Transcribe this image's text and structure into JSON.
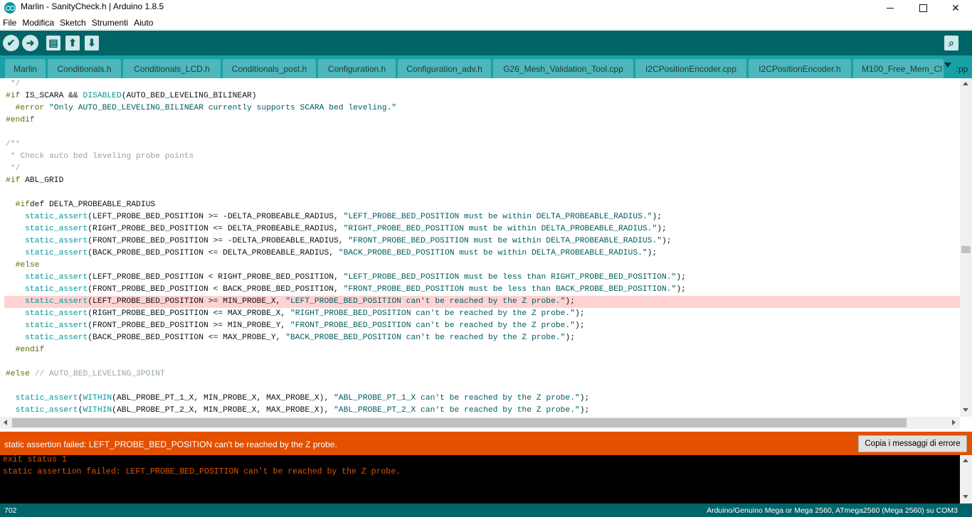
{
  "window": {
    "title": "Marlin - SanityCheck.h | Arduino 1.8.5",
    "minimize_glyph": "",
    "maximize_glyph": "",
    "close_glyph": "✕"
  },
  "menu": [
    "File",
    "Modifica",
    "Sketch",
    "Strumenti",
    "Aiuto"
  ],
  "toolbar": {
    "verify_glyph": "✔",
    "upload_glyph": "➜",
    "new_glyph": "▤",
    "open_glyph": "⬆",
    "save_glyph": "⬇",
    "serial_glyph": "⌕"
  },
  "tabs": [
    "Marlin",
    "Conditionals.h",
    "Conditionals_LCD.h",
    "Conditionals_post.h",
    "Configuration.h",
    "Configuration_adv.h",
    "G26_Mesh_Validation_Tool.cpp",
    "I2CPositionEncoder.cpp",
    "I2CPositionEncoder.h",
    "M100_Free_Mem_Cl",
    ":pp"
  ],
  "code": [
    " */",
    "#if IS_SCARA && DISABLED(AUTO_BED_LEVELING_BILINEAR)",
    "  #error \"Only AUTO_BED_LEVELING_BILINEAR currently supports SCARA bed leveling.\"",
    "#endif",
    "",
    "/**",
    " * Check auto bed leveling probe points",
    " */",
    "#if ABL_GRID",
    "",
    "  #ifdef DELTA_PROBEABLE_RADIUS",
    "    static_assert(LEFT_PROBE_BED_POSITION >= -DELTA_PROBEABLE_RADIUS, \"LEFT_PROBE_BED_POSITION must be within DELTA_PROBEABLE_RADIUS.\");",
    "    static_assert(RIGHT_PROBE_BED_POSITION <= DELTA_PROBEABLE_RADIUS, \"RIGHT_PROBE_BED_POSITION must be within DELTA_PROBEABLE_RADIUS.\");",
    "    static_assert(FRONT_PROBE_BED_POSITION >= -DELTA_PROBEABLE_RADIUS, \"FRONT_PROBE_BED_POSITION must be within DELTA_PROBEABLE_RADIUS.\");",
    "    static_assert(BACK_PROBE_BED_POSITION <= DELTA_PROBEABLE_RADIUS, \"BACK_PROBE_BED_POSITION must be within DELTA_PROBEABLE_RADIUS.\");",
    "  #else",
    "    static_assert(LEFT_PROBE_BED_POSITION < RIGHT_PROBE_BED_POSITION, \"LEFT_PROBE_BED_POSITION must be less than RIGHT_PROBE_BED_POSITION.\");",
    "    static_assert(FRONT_PROBE_BED_POSITION < BACK_PROBE_BED_POSITION, \"FRONT_PROBE_BED_POSITION must be less than BACK_PROBE_BED_POSITION.\");",
    "    static_assert(LEFT_PROBE_BED_POSITION >= MIN_PROBE_X, \"LEFT_PROBE_BED_POSITION can't be reached by the Z probe.\");",
    "    static_assert(RIGHT_PROBE_BED_POSITION <= MAX_PROBE_X, \"RIGHT_PROBE_BED_POSITION can't be reached by the Z probe.\");",
    "    static_assert(FRONT_PROBE_BED_POSITION >= MIN_PROBE_Y, \"FRONT_PROBE_BED_POSITION can't be reached by the Z probe.\");",
    "    static_assert(BACK_PROBE_BED_POSITION <= MAX_PROBE_Y, \"BACK_PROBE_BED_POSITION can't be reached by the Z probe.\");",
    "  #endif",
    "",
    "#else // AUTO_BED_LEVELING_3POINT",
    "",
    "  static_assert(WITHIN(ABL_PROBE_PT_1_X, MIN_PROBE_X, MAX_PROBE_X), \"ABL_PROBE_PT_1_X can't be reached by the Z probe.\");",
    "  static_assert(WITHIN(ABL_PROBE_PT_2_X, MIN_PROBE_X, MAX_PROBE_X), \"ABL_PROBE_PT_2_X can't be reached by the Z probe.\");"
  ],
  "highlighted_line": 18,
  "status": {
    "message": "static assertion failed: LEFT_PROBE_BED_POSITION can't be reached by the Z probe.",
    "copy_button": "Copia i messaggi di errore"
  },
  "console": [
    "exit status 1",
    "static assertion failed: LEFT_PROBE_BED_POSITION can't be reached by the Z probe."
  ],
  "footer": {
    "line_number": "702",
    "board": "Arduino/Genuino Mega or Mega 2560, ATmega2560 (Mega 2560) su COM3"
  },
  "colors": {
    "toolbar": "#006468",
    "tabs": "#17a1a5",
    "error": "#e25000",
    "highlight": "#ffd3d3"
  }
}
